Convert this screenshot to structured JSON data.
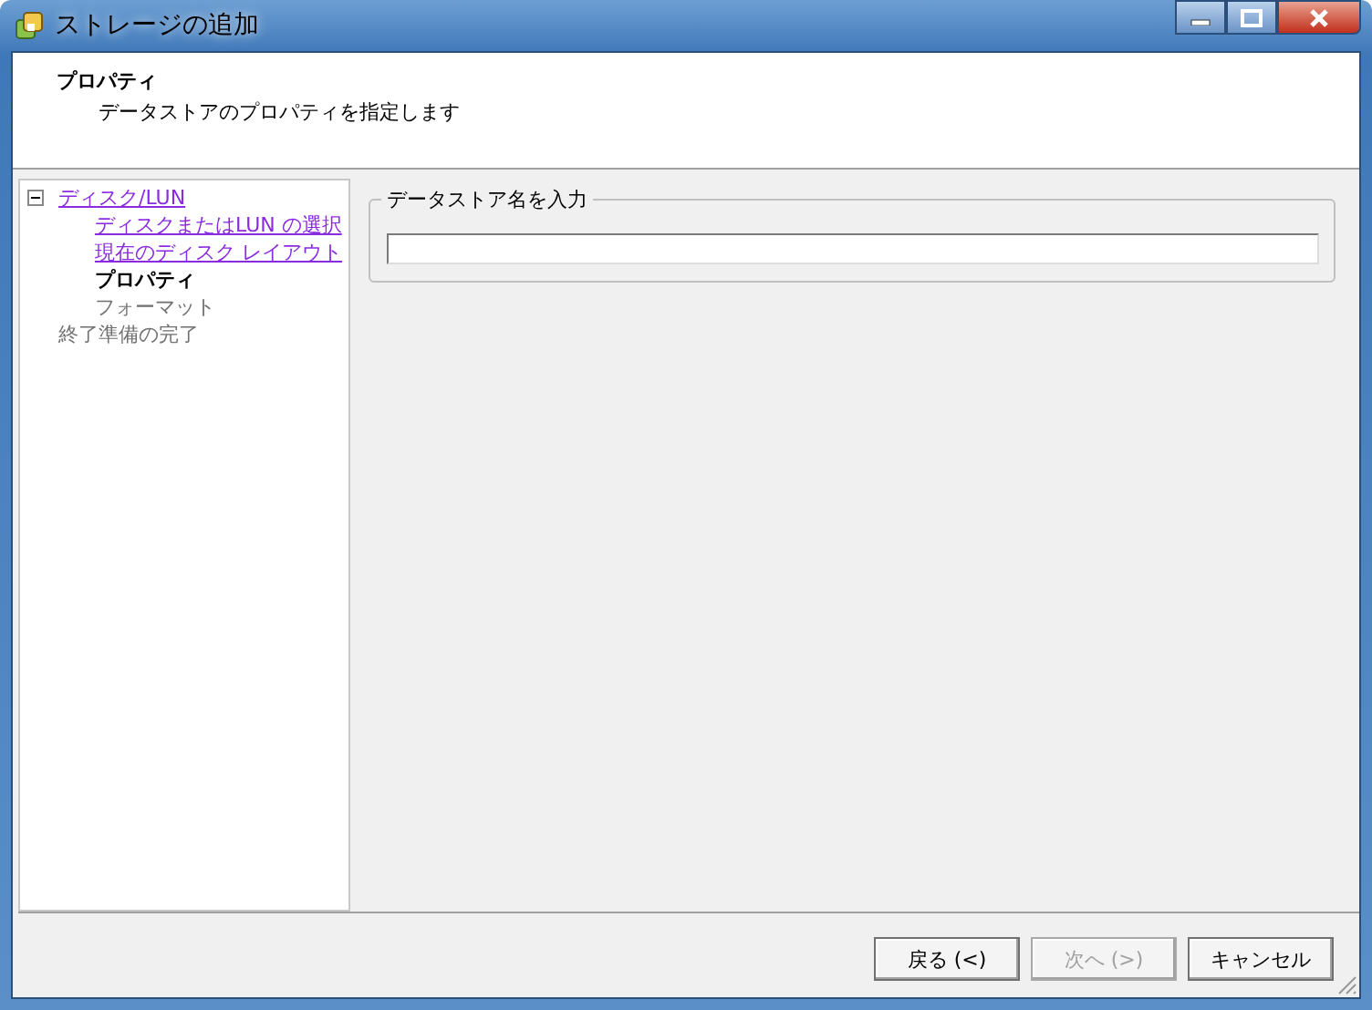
{
  "window": {
    "title": "ストレージの追加"
  },
  "header": {
    "title": "プロパティ",
    "subtitle": "データストアのプロパティを指定します"
  },
  "steps": [
    {
      "label": "ディスク/LUN",
      "visited": true,
      "current": false,
      "expanded": true,
      "children": [
        {
          "label": "ディスクまたはLUN の選択",
          "visited": true,
          "current": false
        },
        {
          "label": "現在のディスク レイアウト",
          "visited": true,
          "current": false
        },
        {
          "label": "プロパティ",
          "visited": false,
          "current": true
        },
        {
          "label": "フォーマット",
          "visited": false,
          "current": false
        }
      ]
    },
    {
      "label": "終了準備の完了",
      "visited": false,
      "current": false
    }
  ],
  "group": {
    "legend": "データストア名を入力"
  },
  "buttons": [
    {
      "label": "戻る (<)",
      "disabled": false
    },
    {
      "label": "次へ (>)",
      "disabled": true
    },
    {
      "label": "キャンセル",
      "disabled": false
    }
  ]
}
